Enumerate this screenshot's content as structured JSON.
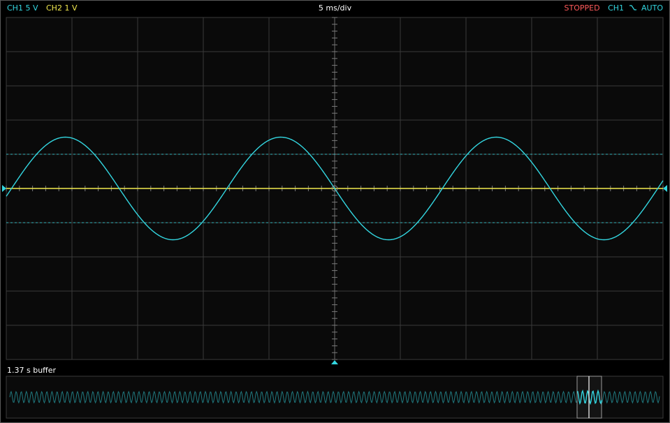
{
  "header": {
    "ch1_scale": "CH1 5 V",
    "ch2_scale": "CH2 1 V",
    "timebase": "5 ms/div",
    "run_state": "STOPPED",
    "trigger_source": "CH1",
    "trigger_edge_icon": "falling-edge",
    "trigger_mode": "AUTO"
  },
  "colors": {
    "ch1": "#33d6e0",
    "ch2": "#f2e94e",
    "stopped": "#ff5a5a",
    "grid": "#3a3a3a",
    "background": "#0a0a0a"
  },
  "footer": {
    "buffer_label": "1.37 s buffer"
  },
  "chart_data": {
    "type": "line",
    "title": "",
    "x_divisions": 10,
    "y_divisions": 10,
    "time_per_div_ms": 5,
    "xlim_ms": [
      -25,
      25
    ],
    "series": [
      {
        "name": "CH1",
        "signal": "sine",
        "amplitude_div": 1.5,
        "period_ms": 16.4,
        "phase_at_center": "zero-crossing-falling"
      },
      {
        "name": "CH2",
        "signal": "flat",
        "level_div": 0
      }
    ],
    "cursors_div": [
      1.0,
      -1.0
    ],
    "grid": true,
    "trigger_level_div": 0
  }
}
